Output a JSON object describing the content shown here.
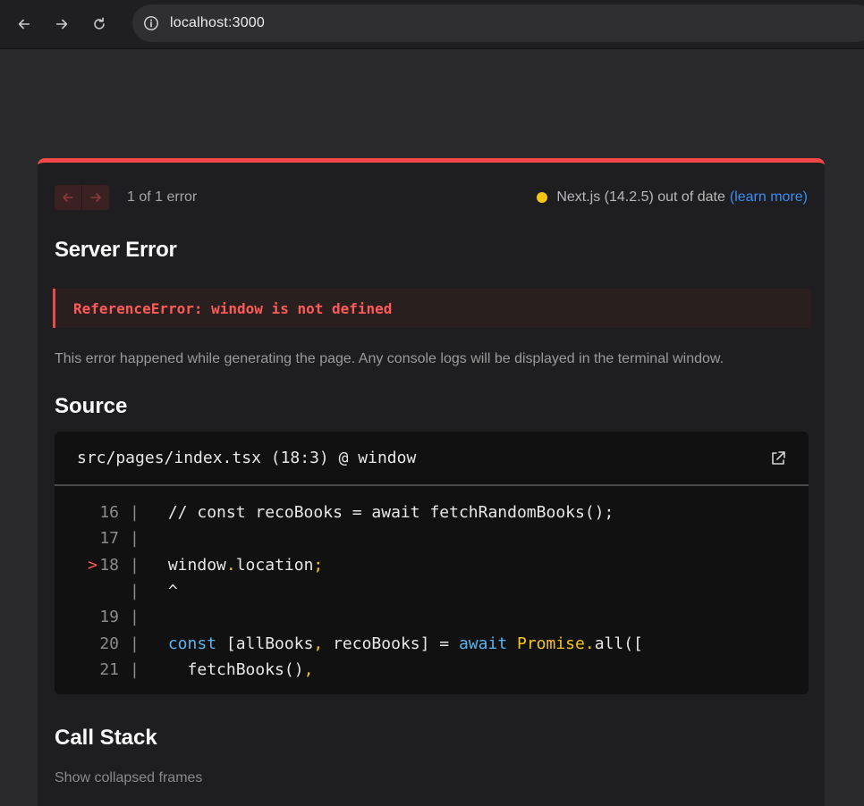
{
  "browser": {
    "url": "localhost:3000"
  },
  "overlay": {
    "error_count": "1 of 1 error",
    "version_text": "Next.js (14.2.5) out of date",
    "learn_more": "(learn more)",
    "title": "Server Error",
    "error_message": "ReferenceError: window is not defined",
    "explanation": "This error happened while generating the page. Any console logs will be displayed in the terminal window.",
    "source_heading": "Source",
    "source_file": "src/pages/index.tsx (18:3) @ window",
    "call_stack_heading": "Call Stack",
    "show_collapsed": "Show collapsed frames",
    "accent_color": "#f24848",
    "warning_dot_color": "#f5c518",
    "link_color": "#3b8cf2"
  },
  "code": {
    "lines": [
      {
        "marker": "",
        "number": "16",
        "text": "// const recoBooks = await fetchRandomBooks();"
      },
      {
        "marker": "",
        "number": "17",
        "text": ""
      },
      {
        "marker": ">",
        "number": "18",
        "text": "window.location;"
      },
      {
        "marker": "",
        "number": "",
        "text": "^"
      },
      {
        "marker": "",
        "number": "19",
        "text": ""
      },
      {
        "marker": "",
        "number": "20",
        "text": "const [allBooks, recoBooks] = await Promise.all(["
      },
      {
        "marker": "",
        "number": "21",
        "text": "  fetchBooks(),"
      }
    ]
  }
}
